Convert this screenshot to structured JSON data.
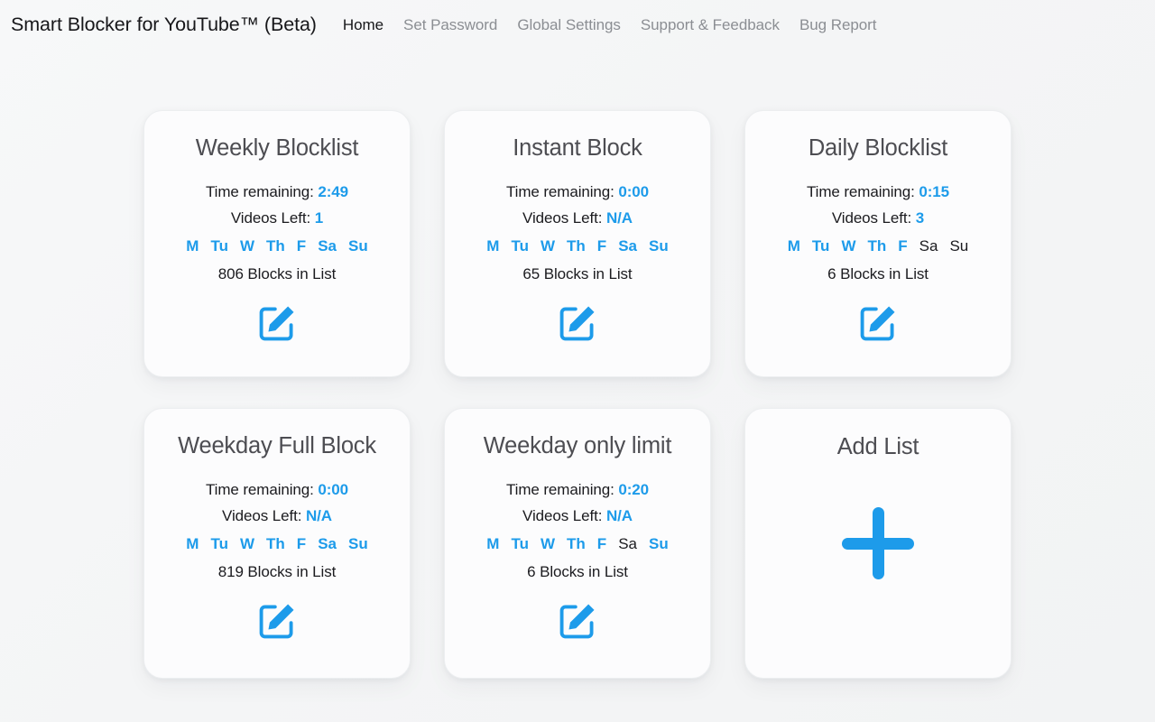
{
  "header": {
    "app_title": "Smart Blocker for YouTube™ (Beta)",
    "nav": [
      {
        "label": "Home",
        "active": true
      },
      {
        "label": "Set Password",
        "active": false
      },
      {
        "label": "Global Settings",
        "active": false
      },
      {
        "label": "Support & Feedback",
        "active": false
      },
      {
        "label": "Bug Report",
        "active": false
      }
    ]
  },
  "labels": {
    "time_remaining": "Time remaining:",
    "videos_left": "Videos Left:",
    "blocks_suffix": "Blocks in List",
    "edit_icon": "edit-icon",
    "plus_icon": "plus-icon"
  },
  "colors": {
    "accent": "#1d9bea",
    "title": "#4d4d52",
    "text": "#1b1b1f",
    "nav_inactive": "#8b8e93",
    "card_bg": "#fcfcfd",
    "page_bg": "#f5f6f7"
  },
  "day_names": [
    "M",
    "Tu",
    "W",
    "Th",
    "F",
    "Sa",
    "Su"
  ],
  "cards": [
    {
      "title": "Weekly Blocklist",
      "time_remaining": "2:49",
      "videos_left": "1",
      "days_active": [
        true,
        true,
        true,
        true,
        true,
        true,
        true
      ],
      "blocks_count": "806",
      "blocks_text": "806 Blocks in List"
    },
    {
      "title": "Instant Block",
      "time_remaining": "0:00",
      "videos_left": "N/A",
      "days_active": [
        true,
        true,
        true,
        true,
        true,
        true,
        true
      ],
      "blocks_count": "65",
      "blocks_text": "65 Blocks in List"
    },
    {
      "title": "Daily Blocklist",
      "time_remaining": "0:15",
      "videos_left": "3",
      "days_active": [
        true,
        true,
        true,
        true,
        true,
        false,
        false
      ],
      "blocks_count": "6",
      "blocks_text": "6 Blocks in List"
    },
    {
      "title": "Weekday Full Block",
      "time_remaining": "0:00",
      "videos_left": "N/A",
      "days_active": [
        true,
        true,
        true,
        true,
        true,
        true,
        true
      ],
      "blocks_count": "819",
      "blocks_text": "819 Blocks in List"
    },
    {
      "title": "Weekday only limit",
      "time_remaining": "0:20",
      "videos_left": "N/A",
      "days_active": [
        true,
        true,
        true,
        true,
        true,
        false,
        true
      ],
      "blocks_count": "6",
      "blocks_text": "6 Blocks in List"
    }
  ],
  "add_card": {
    "title": "Add List"
  }
}
